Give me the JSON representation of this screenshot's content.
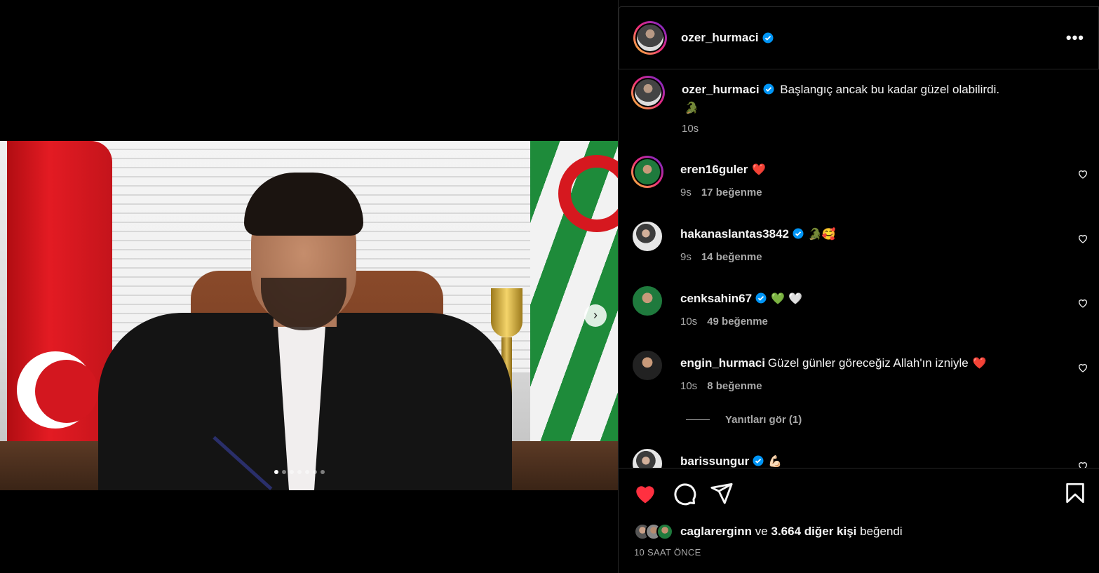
{
  "post": {
    "author": "ozer_hurmaci",
    "caption": "Başlangıç ancak bu kadar güzel olabilirdi.",
    "caption_emoji": "🐊",
    "caption_age": "10s",
    "carousel_total": 7,
    "carousel_index": 1,
    "likes_summary": {
      "first_user": "caglarerginn",
      "conjunction": "ve",
      "others": "3.664 diğer kişi",
      "suffix": "beğendi"
    },
    "time_ago": "10 SAAT ÖNCE"
  },
  "comments": [
    {
      "user": "eren16guler",
      "verified": false,
      "text": "",
      "emoji": "❤️",
      "age": "9s",
      "likes": "17 beğenme"
    },
    {
      "user": "hakanaslantas3842",
      "verified": true,
      "text": "",
      "emoji": "🐊🥰",
      "age": "9s",
      "likes": "14 beğenme"
    },
    {
      "user": "cenksahin67",
      "verified": true,
      "text": "",
      "emoji": "💚 🤍",
      "age": "10s",
      "likes": "49 beğenme"
    },
    {
      "user": "engin_hurmaci",
      "verified": false,
      "text": "Güzel günler göreceğiz Allah'ın izniyle",
      "emoji": "❤️",
      "age": "10s",
      "likes": "8 beğenme"
    },
    {
      "user": "barissungur",
      "verified": true,
      "text": "",
      "emoji": "💪🏻",
      "age": "",
      "likes": ""
    }
  ],
  "view_replies": "Yanıtları gör (1)",
  "icons": {
    "more": "more-horizontal-icon",
    "like": "heart-filled-icon",
    "comment": "comment-icon",
    "share": "share-icon",
    "save": "bookmark-icon",
    "next": "chevron-right-icon"
  },
  "colors": {
    "background": "#000000",
    "text": "#f5f5f5",
    "secondary_text": "#a8a8a8",
    "heart_red": "#ff3040",
    "verified_blue": "#0095f6",
    "divider": "#262626"
  }
}
